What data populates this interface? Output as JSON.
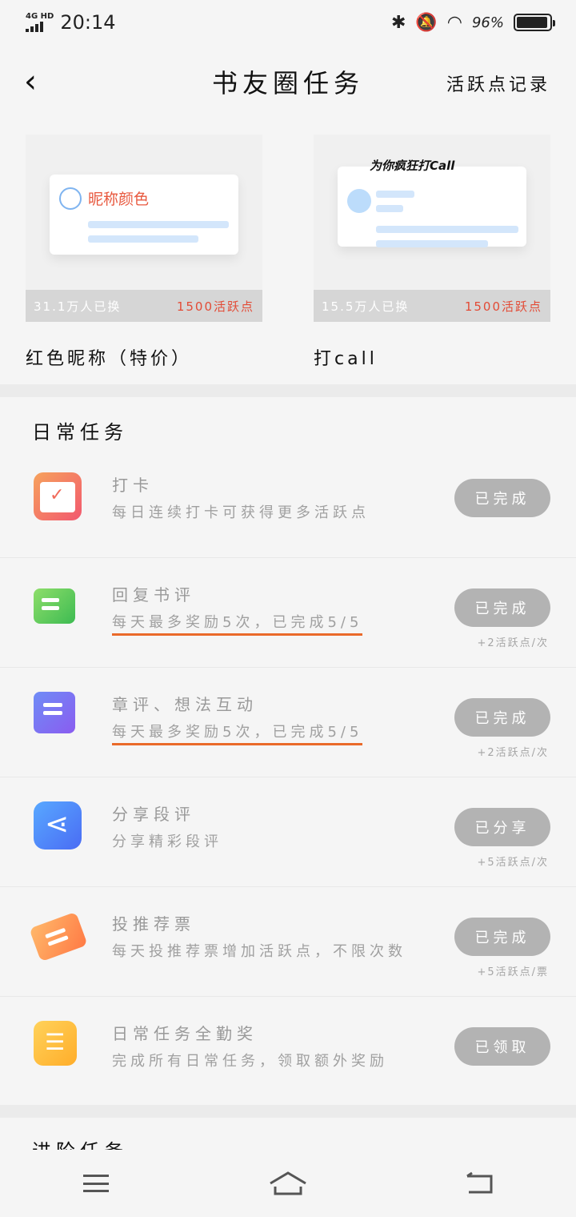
{
  "status_bar": {
    "network": "4G HD",
    "time": "20:14",
    "battery": "96%",
    "battery_level": 0.96
  },
  "nav": {
    "back_icon": "chevron-left-icon",
    "title": "书友圈任务",
    "right_link": "活跃点记录"
  },
  "rewards": [
    {
      "name": "红色昵称（特价）",
      "exchanged": "31.1万人已换",
      "points": "1500活跃点",
      "preview_text": "昵称颜色"
    },
    {
      "name": "打call",
      "exchanged": "15.5万人已换",
      "points": "1500活跃点",
      "preview_text": "为你疯狂打Call"
    }
  ],
  "daily": {
    "title": "日常任务",
    "tasks": [
      {
        "name": "打卡",
        "desc": "每日连续打卡可获得更多活跃点",
        "button": "已完成",
        "bonus": "",
        "icon": "calendar-check-icon"
      },
      {
        "name": "回复书评",
        "desc": "每天最多奖励5次，已完成5/5",
        "button": "已完成",
        "bonus": "+2活跃点/次",
        "icon": "chat-icon"
      },
      {
        "name": "章评、想法互动",
        "desc": "每天最多奖励5次，已完成5/5",
        "button": "已完成",
        "bonus": "+2活跃点/次",
        "icon": "document-icon"
      },
      {
        "name": "分享段评",
        "desc": "分享精彩段评",
        "button": "已分享",
        "bonus": "+5活跃点/次",
        "icon": "share-icon"
      },
      {
        "name": "投推荐票",
        "desc": "每天投推荐票增加活跃点，不限次数",
        "button": "已完成",
        "bonus": "+5活跃点/票",
        "icon": "ticket-icon"
      },
      {
        "name": "日常任务全勤奖",
        "desc": "完成所有日常任务，领取额外奖励",
        "button": "已领取",
        "bonus": "",
        "icon": "list-icon"
      }
    ]
  },
  "advanced": {
    "title": "进阶任务"
  },
  "bottom_nav": {
    "menu_icon": "menu-icon",
    "home_icon": "home-icon",
    "back_icon": "return-icon"
  }
}
